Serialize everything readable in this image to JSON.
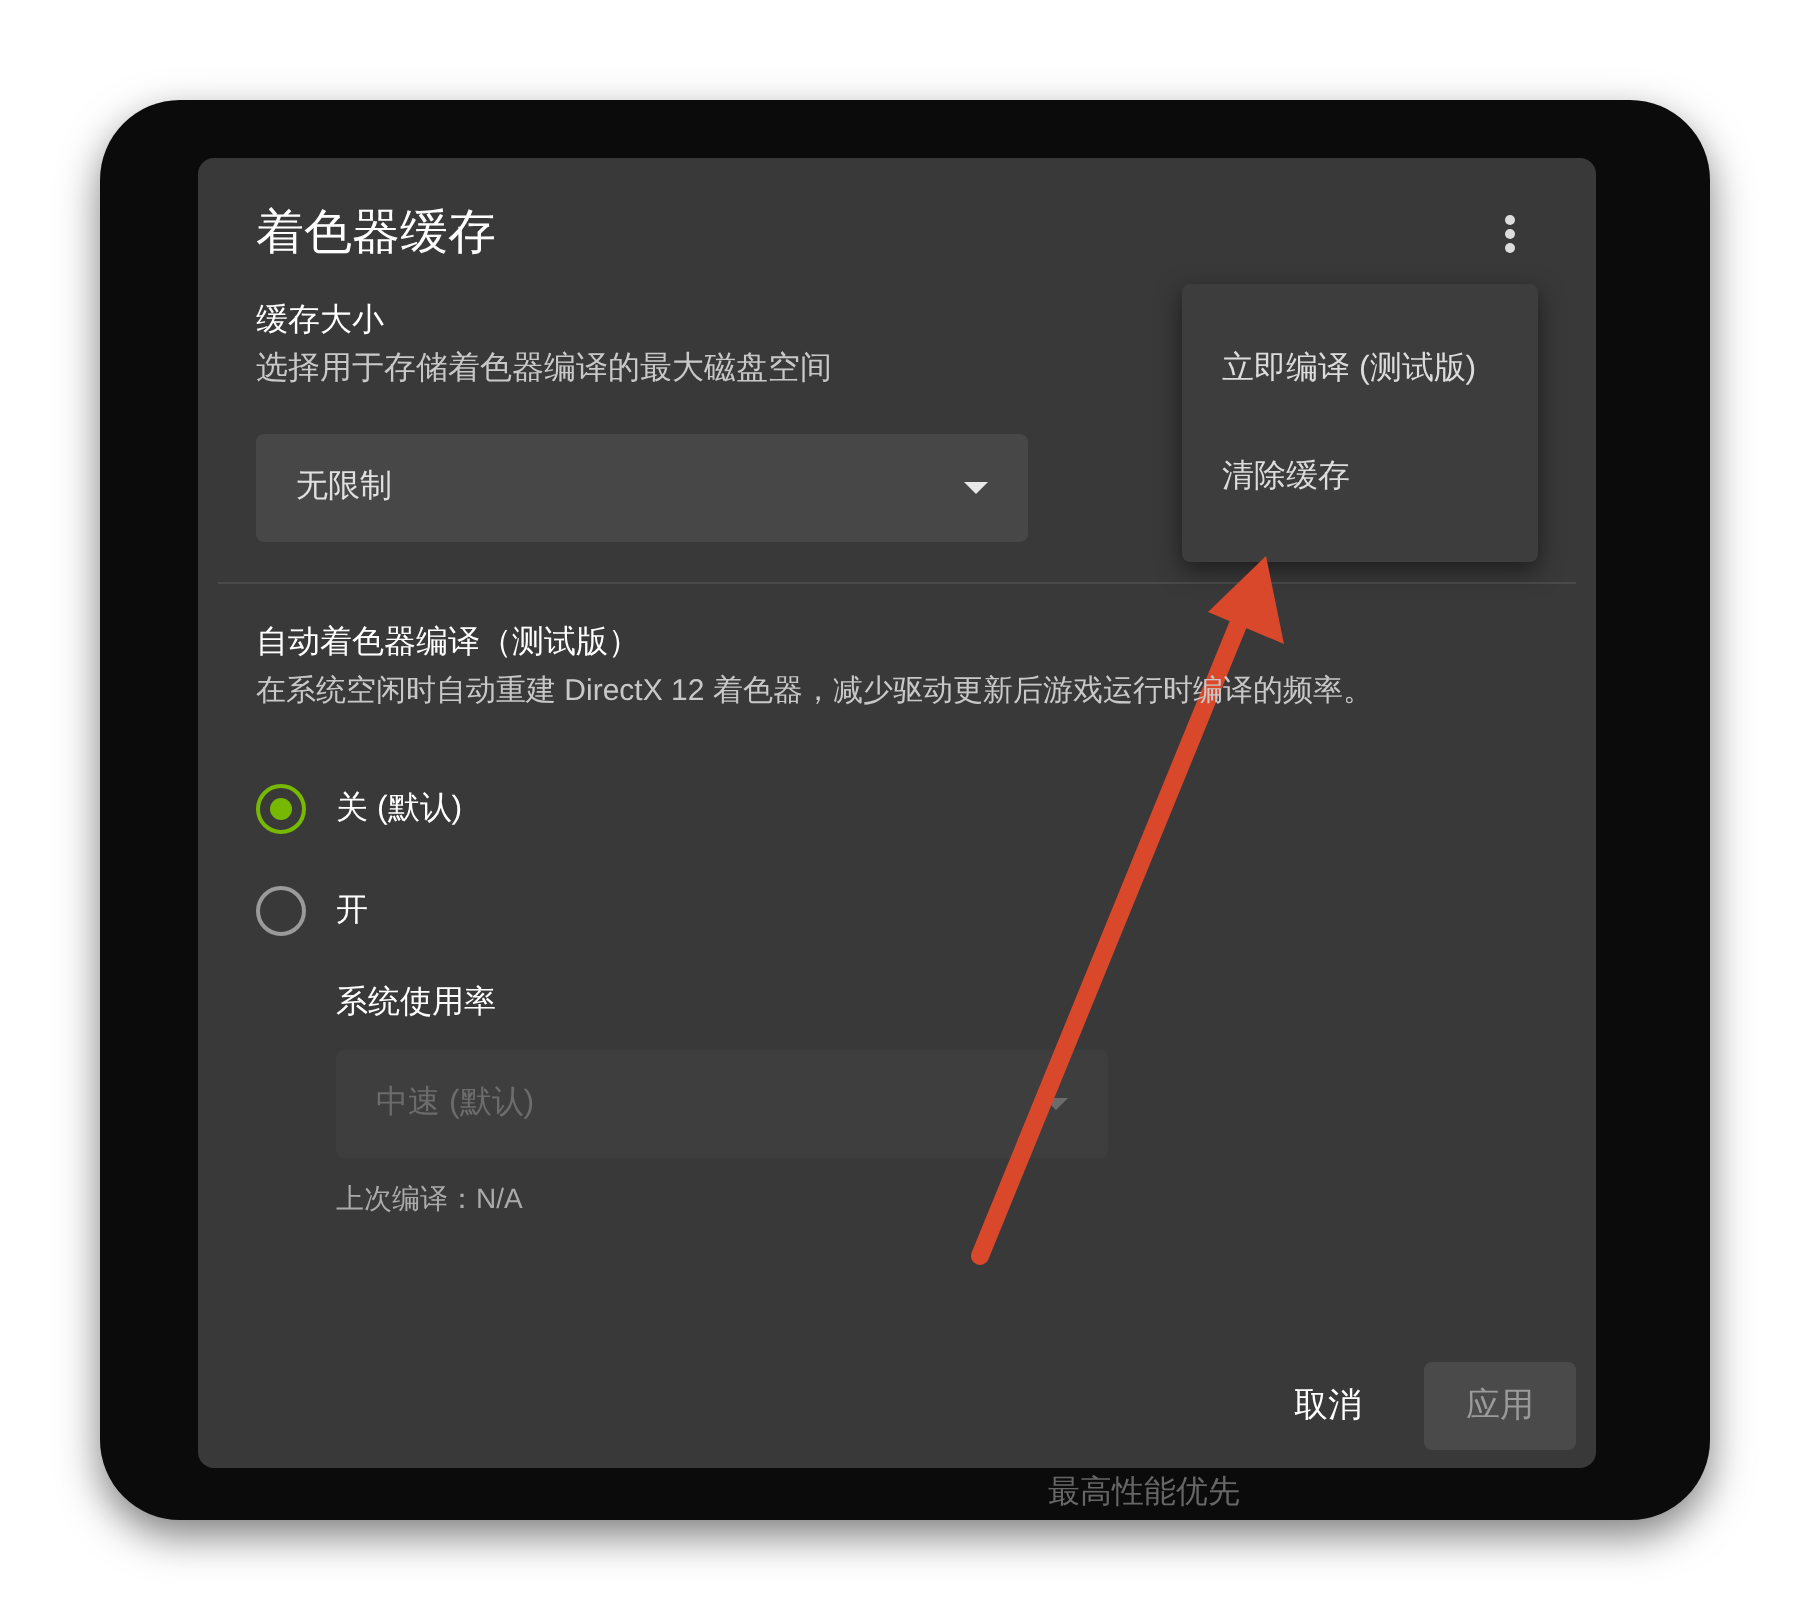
{
  "dialog": {
    "title": "着色器缓存",
    "cache_size": {
      "label": "缓存大小",
      "description": "选择用于存储着色器编译的最大磁盘空间",
      "select": {
        "value": "无限制",
        "disabled": false
      }
    },
    "auto_compile": {
      "label": "自动着色器编译（测试版）",
      "description": "在系统空闲时自动重建 DirectX 12 着色器，减少驱动更新后游戏运行时编译的频率。",
      "options": [
        {
          "label": "关 (默认)",
          "selected": true
        },
        {
          "label": "开",
          "selected": false
        }
      ],
      "usage": {
        "label": "系统使用率",
        "select": {
          "value": "中速 (默认)",
          "disabled": true
        }
      },
      "last_compile": "上次编译：N/A"
    },
    "buttons": [
      {
        "label": "取消",
        "kind": "text",
        "disabled": false
      },
      {
        "label": "应用",
        "kind": "filled",
        "disabled": true
      }
    ]
  },
  "menu": {
    "items": [
      {
        "label": "立即编译 (测试版)"
      },
      {
        "label": "清除缓存"
      }
    ]
  },
  "background_text": "最高性能优先"
}
